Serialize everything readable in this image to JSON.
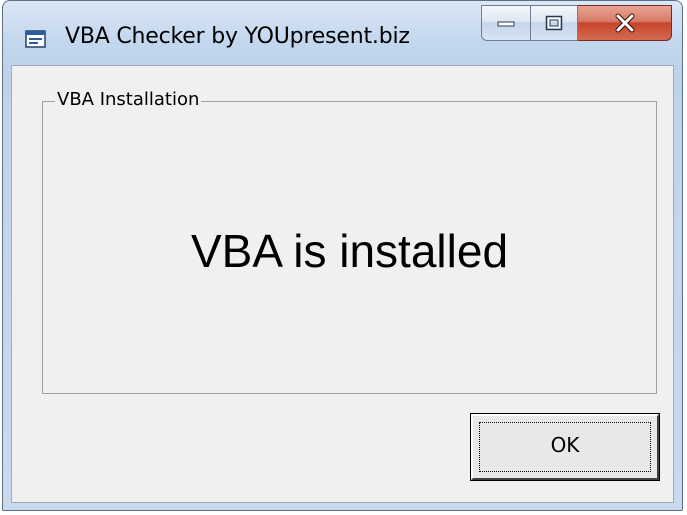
{
  "window": {
    "title": "VBA Checker by YOUpresent.biz",
    "app_icon": "window-app-icon"
  },
  "caption_buttons": {
    "minimize_icon": "minimize-icon",
    "maximize_icon": "maximize-icon",
    "close_icon": "close-icon",
    "close_color": "#c7452c"
  },
  "group": {
    "legend": "VBA Installation",
    "status_message": "VBA is installed"
  },
  "buttons": {
    "ok_label": "OK"
  }
}
